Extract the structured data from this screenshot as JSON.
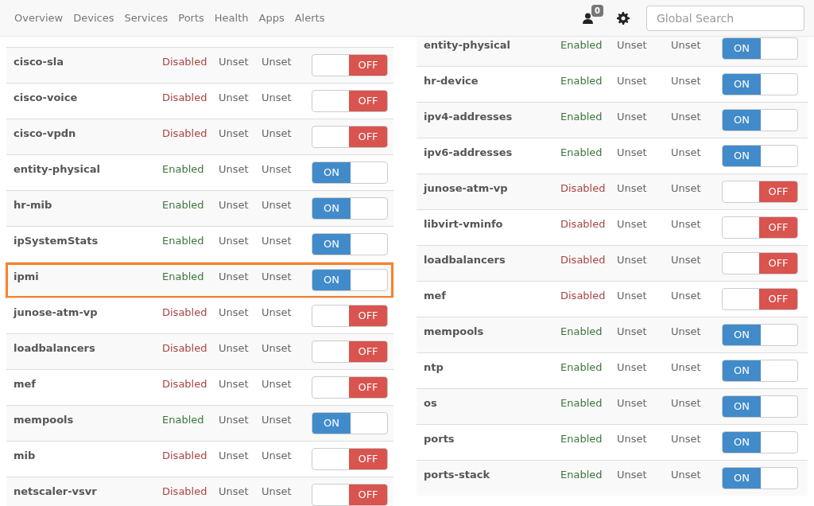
{
  "navbar": {
    "links": [
      "Overview",
      "Devices",
      "Services",
      "Ports",
      "Health",
      "Apps",
      "Alerts"
    ],
    "notification_count": "0",
    "search": {
      "placeholder": "Global Search"
    }
  },
  "left_table": [
    {
      "name": "cisco-sla",
      "status": "Disabled",
      "col_3": "Unset",
      "col_4": "Unset",
      "on": false,
      "toggle_label": "OFF",
      "highlighted": false
    },
    {
      "name": "cisco-voice",
      "status": "Disabled",
      "col_3": "Unset",
      "col_4": "Unset",
      "on": false,
      "toggle_label": "OFF",
      "highlighted": false
    },
    {
      "name": "cisco-vpdn",
      "status": "Disabled",
      "col_3": "Unset",
      "col_4": "Unset",
      "on": false,
      "toggle_label": "OFF",
      "highlighted": false
    },
    {
      "name": "entity-physical",
      "status": "Enabled",
      "col_3": "Unset",
      "col_4": "Unset",
      "on": true,
      "toggle_label": "ON",
      "highlighted": false
    },
    {
      "name": "hr-mib",
      "status": "Enabled",
      "col_3": "Unset",
      "col_4": "Unset",
      "on": true,
      "toggle_label": "ON",
      "highlighted": false
    },
    {
      "name": "ipSystemStats",
      "status": "Enabled",
      "col_3": "Unset",
      "col_4": "Unset",
      "on": true,
      "toggle_label": "ON",
      "highlighted": false
    },
    {
      "name": "ipmi",
      "status": "Enabled",
      "col_3": "Unset",
      "col_4": "Unset",
      "on": true,
      "toggle_label": "ON",
      "highlighted": true
    },
    {
      "name": "junose-atm-vp",
      "status": "Disabled",
      "col_3": "Unset",
      "col_4": "Unset",
      "on": false,
      "toggle_label": "OFF",
      "highlighted": false
    },
    {
      "name": "loadbalancers",
      "status": "Disabled",
      "col_3": "Unset",
      "col_4": "Unset",
      "on": false,
      "toggle_label": "OFF",
      "highlighted": false
    },
    {
      "name": "mef",
      "status": "Disabled",
      "col_3": "Unset",
      "col_4": "Unset",
      "on": false,
      "toggle_label": "OFF",
      "highlighted": false
    },
    {
      "name": "mempools",
      "status": "Enabled",
      "col_3": "Unset",
      "col_4": "Unset",
      "on": true,
      "toggle_label": "ON",
      "highlighted": false
    },
    {
      "name": "mib",
      "status": "Disabled",
      "col_3": "Unset",
      "col_4": "Unset",
      "on": false,
      "toggle_label": "OFF",
      "highlighted": false
    },
    {
      "name": "netscaler-vsvr",
      "status": "Disabled",
      "col_3": "Unset",
      "col_4": "Unset",
      "on": false,
      "toggle_label": "OFF",
      "highlighted": false
    }
  ],
  "right_table": [
    {
      "name": "entity-physical",
      "status": "Enabled",
      "col_3": "Unset",
      "col_4": "Unset",
      "on": true,
      "toggle_label": "ON",
      "highlighted": false
    },
    {
      "name": "hr-device",
      "status": "Enabled",
      "col_3": "Unset",
      "col_4": "Unset",
      "on": true,
      "toggle_label": "ON",
      "highlighted": false
    },
    {
      "name": "ipv4-addresses",
      "status": "Enabled",
      "col_3": "Unset",
      "col_4": "Unset",
      "on": true,
      "toggle_label": "ON",
      "highlighted": false
    },
    {
      "name": "ipv6-addresses",
      "status": "Enabled",
      "col_3": "Unset",
      "col_4": "Unset",
      "on": true,
      "toggle_label": "ON",
      "highlighted": false
    },
    {
      "name": "junose-atm-vp",
      "status": "Disabled",
      "col_3": "Unset",
      "col_4": "Unset",
      "on": false,
      "toggle_label": "OFF",
      "highlighted": false
    },
    {
      "name": "libvirt-vminfo",
      "status": "Disabled",
      "col_3": "Unset",
      "col_4": "Unset",
      "on": false,
      "toggle_label": "OFF",
      "highlighted": false
    },
    {
      "name": "loadbalancers",
      "status": "Disabled",
      "col_3": "Unset",
      "col_4": "Unset",
      "on": false,
      "toggle_label": "OFF",
      "highlighted": false
    },
    {
      "name": "mef",
      "status": "Disabled",
      "col_3": "Unset",
      "col_4": "Unset",
      "on": false,
      "toggle_label": "OFF",
      "highlighted": false
    },
    {
      "name": "mempools",
      "status": "Enabled",
      "col_3": "Unset",
      "col_4": "Unset",
      "on": true,
      "toggle_label": "ON",
      "highlighted": false
    },
    {
      "name": "ntp",
      "status": "Enabled",
      "col_3": "Unset",
      "col_4": "Unset",
      "on": true,
      "toggle_label": "ON",
      "highlighted": false
    },
    {
      "name": "os",
      "status": "Enabled",
      "col_3": "Unset",
      "col_4": "Unset",
      "on": true,
      "toggle_label": "ON",
      "highlighted": false
    },
    {
      "name": "ports",
      "status": "Enabled",
      "col_3": "Unset",
      "col_4": "Unset",
      "on": true,
      "toggle_label": "ON",
      "highlighted": false
    },
    {
      "name": "ports-stack",
      "status": "Enabled",
      "col_3": "Unset",
      "col_4": "Unset",
      "on": true,
      "toggle_label": "ON",
      "highlighted": false
    }
  ]
}
